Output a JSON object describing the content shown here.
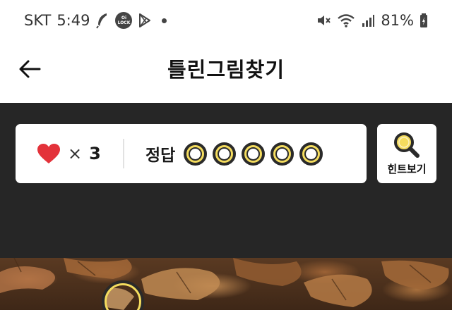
{
  "status_bar": {
    "carrier": "SKT",
    "time": "5:49",
    "battery": "81%",
    "left_icons": [
      "feather-icon",
      "lock-app-icon",
      "play-store-icon",
      "notification-dot"
    ],
    "right_icons": [
      "mute-icon",
      "wifi-icon",
      "signal-icon",
      "battery-icon"
    ],
    "lock_badge_top": "Oi",
    "lock_badge_bottom": "LOCK"
  },
  "header": {
    "title": "틀린그림찾기",
    "back_icon": "back-arrow-icon"
  },
  "scoreboard": {
    "lives_icon": "heart-icon",
    "lives_times": "×",
    "lives_count": "3",
    "answers_label": "정답",
    "answer_slots": 5,
    "answers_found": 0
  },
  "hint": {
    "label": "힌트보기",
    "icon": "magnifier-icon"
  },
  "colors": {
    "accent_yellow": "#f4dc5e",
    "heart_red": "#e3323a",
    "dark_panel": "#262626"
  }
}
